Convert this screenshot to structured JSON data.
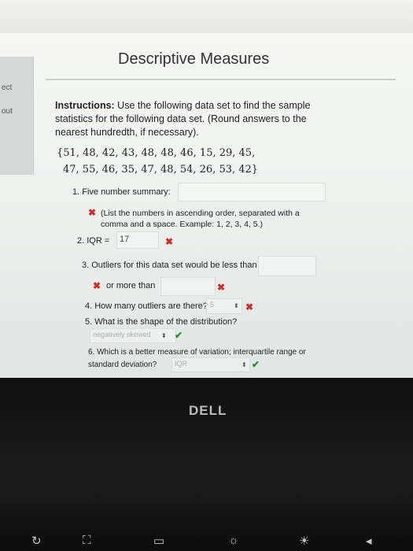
{
  "sidebar": {
    "item1": "ect",
    "item2": "out"
  },
  "page": {
    "title": "Descriptive Measures",
    "instructions_label": "Instructions:",
    "instructions_text": " Use the following data set to find the sample statistics for the following data set. (Round answers to the nearest hundredth, if necessary).",
    "dataset_line1": "{51, 48, 42, 43, 48, 48, 46, 15, 29, 45,",
    "dataset_line2": "47, 55, 46, 35, 47, 48, 54, 26, 53, 42}"
  },
  "questions": {
    "q1_label": "1. Five number summary:",
    "q1_hint": "(List the numbers in ascending order, separated with a comma and a space. Example: 1, 2, 3, 4, 5.)",
    "q2_label": "2. IQR =",
    "q2_value": "17",
    "q3_label": "3. Outliers for this data set would be less than",
    "q3_more": "or more than",
    "q4_label": "4. How many outliers are there?",
    "q4_value": "5",
    "q5_label": "5. What is the shape of the distribution?",
    "q5_value": "negatively skewed",
    "q6_label": "6. Which is a better measure of variation; interquartile range or standard deviation?",
    "q6_value": "IQR"
  },
  "marks": {
    "wrong": "✖",
    "correct": "✔",
    "spinner": "⬍"
  },
  "laptop": {
    "brand": "DELL"
  },
  "colors": {
    "wrong": "#d32a2a",
    "correct": "#2e8b2e"
  }
}
